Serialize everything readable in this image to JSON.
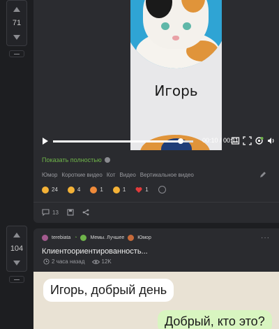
{
  "post1": {
    "votes": "71",
    "video": {
      "caption": "Игорь",
      "time": "00:10 / 00:11",
      "progress": 0.91
    },
    "show_full": "Показать полностью",
    "tags": [
      "Юмор",
      "Короткие видео",
      "Кот",
      "Видео",
      "Вертикальное видео"
    ],
    "reactions": [
      {
        "emoji": "laughing-face",
        "count": "24"
      },
      {
        "emoji": "heart-eyes-face",
        "count": "4"
      },
      {
        "emoji": "angry-face",
        "count": "1"
      },
      {
        "emoji": "grimacing-face",
        "count": "1"
      },
      {
        "emoji": "red-heart",
        "count": "1"
      }
    ],
    "comments": "13"
  },
  "post2": {
    "votes": "104",
    "author": "terebiata",
    "communities": [
      "Мемы. Лучшее",
      "Юмор"
    ],
    "title": "Клиентоориентированность...",
    "time_ago": "2 часа назад",
    "views": "12K",
    "chat": {
      "incoming": "Игорь, добрый день",
      "outgoing": "Добрый, кто это?"
    }
  },
  "colors": {
    "background": "#1d1e21",
    "card": "#2a2b2f",
    "accent_green": "#6fb44a"
  }
}
